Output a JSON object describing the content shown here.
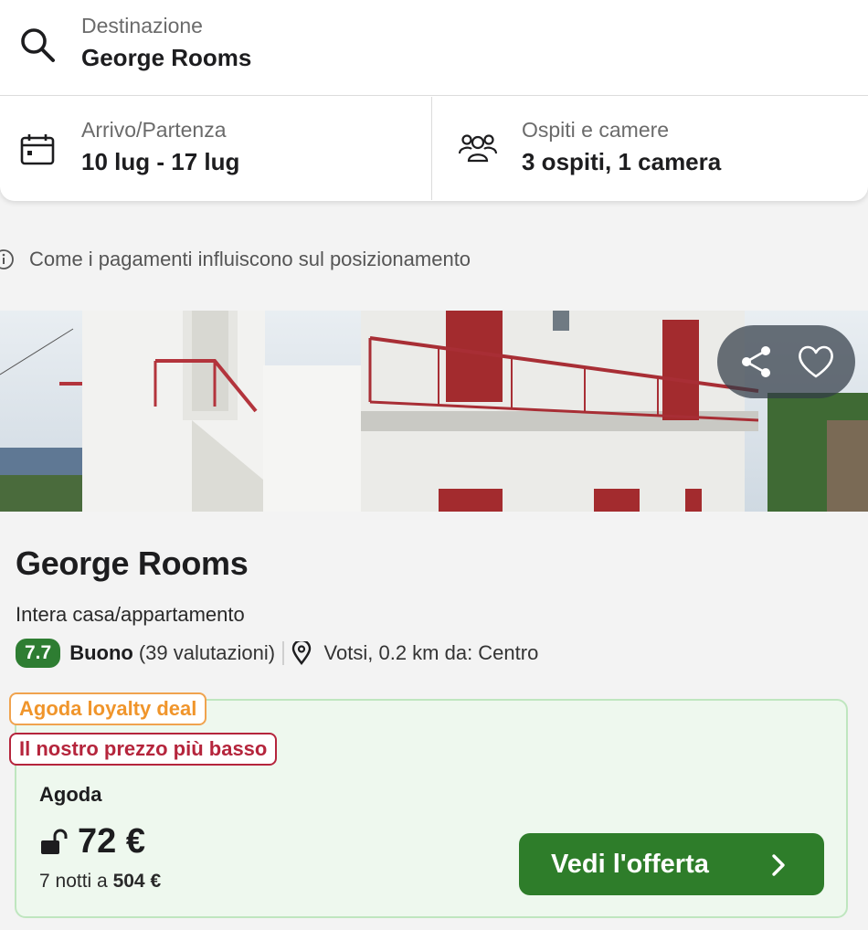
{
  "search": {
    "destination_label": "Destinazione",
    "destination_value": "George Rooms",
    "dates_label": "Arrivo/Partenza",
    "dates_value": "10 lug - 17 lug",
    "guests_label": "Ospiti e camere",
    "guests_value": "3 ospiti, 1 camera"
  },
  "payments_info": "Come i pagamenti influiscono sul posizionamento",
  "hotel": {
    "name": "George Rooms",
    "type": "Intera casa/appartamento",
    "score": "7.7",
    "rating_word": "Buono",
    "rating_count": "(39 valutazioni)",
    "location": "Votsi, 0.2 km da: Centro"
  },
  "offer": {
    "badge_loyalty": "Agoda loyalty deal",
    "badge_lowest": "Il nostro prezzo più basso",
    "provider": "Agoda",
    "price": "72 €",
    "nights_prefix": "7 notti a",
    "total": "504 €",
    "cta": "Vedi l'offerta"
  },
  "colors": {
    "score_green": "#2e7d32",
    "cta_green": "#2e7d2a",
    "loyalty_orange": "#f0952b",
    "lowest_red": "#b5253c",
    "offer_bg": "#eef8ee"
  },
  "icons": [
    "search-icon",
    "calendar-icon",
    "guests-icon",
    "info-icon",
    "share-icon",
    "heart-icon",
    "location-pin-icon",
    "unlock-icon",
    "chevron-right-icon"
  ]
}
